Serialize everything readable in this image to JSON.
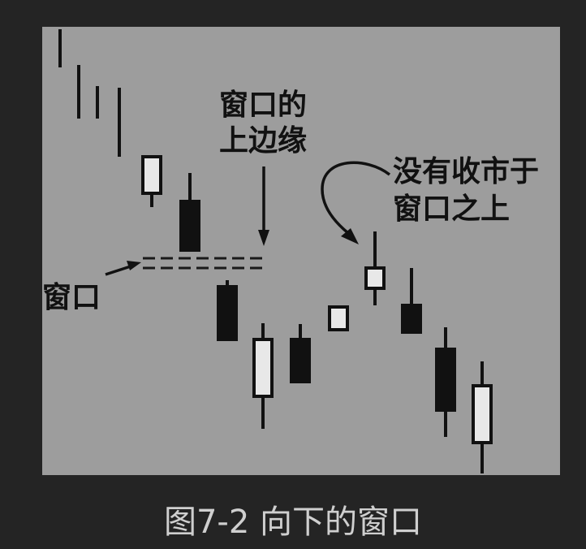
{
  "caption": "图7-2 向下的窗口",
  "chart_data": {
    "type": "candlestick",
    "candles": [
      {
        "open": 20,
        "close": 20,
        "high": 3,
        "low": 50,
        "direction": "line"
      },
      {
        "open": 50,
        "close": 50,
        "high": 47,
        "low": 113,
        "direction": "line"
      },
      {
        "open": 80,
        "close": 80,
        "high": 73,
        "low": 113,
        "direction": "line"
      },
      {
        "open": 100,
        "close": 100,
        "high": 75,
        "low": 160,
        "direction": "line"
      },
      {
        "open": 205,
        "close": 160,
        "high": 158,
        "low": 222,
        "direction": "up"
      },
      {
        "open": 215,
        "close": 275,
        "high": 180,
        "low": 275,
        "direction": "down"
      },
      {
        "open": 320,
        "close": 385,
        "high": 312,
        "low": 385,
        "direction": "down"
      },
      {
        "open": 455,
        "close": 385,
        "high": 365,
        "low": 495,
        "direction": "up"
      },
      {
        "open": 385,
        "close": 437,
        "high": 366,
        "low": 437,
        "direction": "down"
      },
      {
        "open": 373,
        "close": 345,
        "high": 345,
        "low": 373,
        "direction": "up"
      },
      {
        "open": 322,
        "close": 297,
        "high": 252,
        "low": 343,
        "direction": "up"
      },
      {
        "open": 343,
        "close": 376,
        "high": 297,
        "low": 376,
        "direction": "down"
      },
      {
        "open": 397,
        "close": 472,
        "high": 370,
        "low": 505,
        "direction": "down"
      },
      {
        "open": 512,
        "close": 442,
        "high": 412,
        "low": 550,
        "direction": "up"
      }
    ],
    "gap_levels": [
      285,
      297
    ],
    "annotations": {
      "window": "窗口",
      "upper_edge_line1": "窗口的",
      "upper_edge_line2": "上边缘",
      "no_close_line1": "没有收市于",
      "no_close_line2": "窗口之上"
    },
    "colors": {
      "background": "#9d9d9d",
      "candle": "#111111",
      "hollow": "#e8e8e8"
    }
  }
}
